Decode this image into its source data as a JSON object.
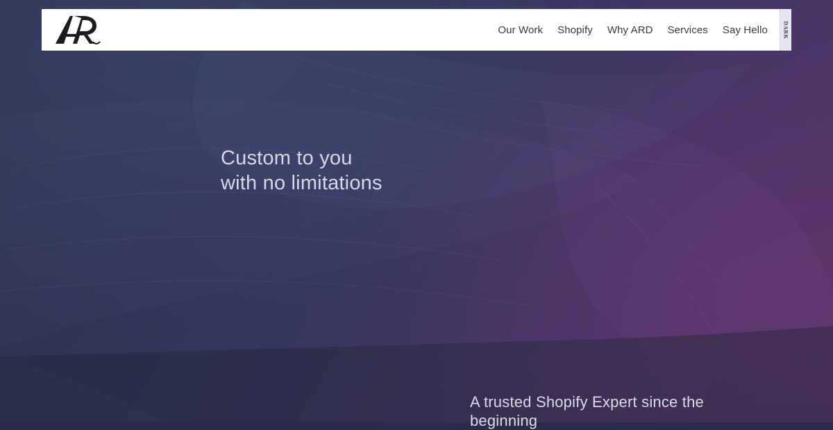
{
  "header": {
    "logo_text": "AR",
    "nav": [
      {
        "label": "Our Work"
      },
      {
        "label": "Shopify"
      },
      {
        "label": "Why ARD"
      },
      {
        "label": "Services"
      },
      {
        "label": "Say Hello"
      }
    ],
    "theme_toggle_label": "DARK"
  },
  "hero": {
    "headline_line_1": "Custom to you",
    "headline_line_2": "with no limitations"
  },
  "next_section": {
    "heading_line_1": "A trusted Shopify Expert since the",
    "heading_line_2": "beginning"
  },
  "colors": {
    "hero_bg": "#35365e",
    "band_bg": "#22262f",
    "nav_bg": "#ffffff",
    "nav_text": "#3b3b3b",
    "headline_text": "#d7d8e6"
  }
}
